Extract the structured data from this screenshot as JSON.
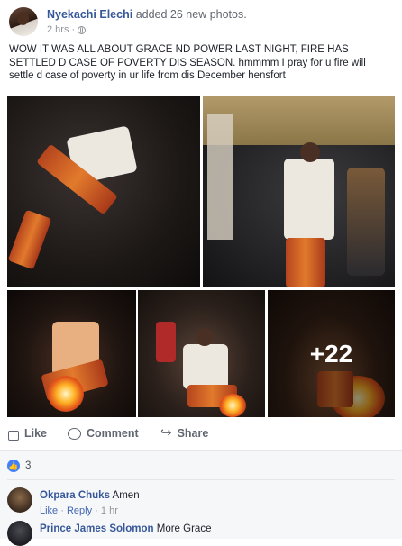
{
  "post": {
    "author": "Nyekachi Elechi",
    "action": "added 26 new photos.",
    "time": "2 hrs",
    "audience_icon": "globe-icon",
    "text": "WOW IT WAS ALL ABOUT GRACE ND POWER LAST NIGHT, FIRE HAS SETTLED D CASE OF POVERTY DIS SEASON. hmmmm I pray for u fire will settle d case of poverty in ur life from dis December hensfort"
  },
  "photos": {
    "more_count": "+22"
  },
  "actions": {
    "like": "Like",
    "comment": "Comment",
    "share": "Share"
  },
  "reactions": {
    "count": "3",
    "icon": "like-reaction-icon"
  },
  "comments": [
    {
      "name": "Okpara Chuks",
      "text": "Amen",
      "like": "Like",
      "reply": "Reply",
      "sep": "·",
      "time": "1 hr"
    },
    {
      "name": "Prince James Solomon",
      "text": "More Grace"
    }
  ],
  "colors": {
    "link_blue": "#365899",
    "meta_gray": "#90949c",
    "reaction_blue": "#4080ff"
  }
}
